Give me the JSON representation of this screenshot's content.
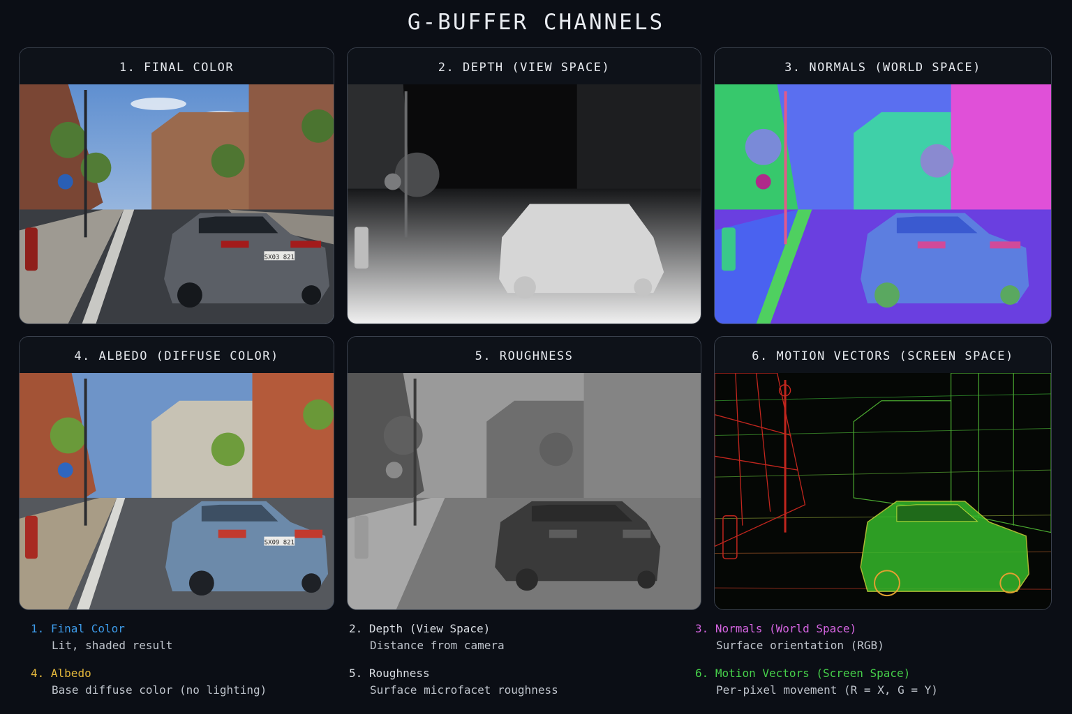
{
  "title": "G-BUFFER CHANNELS",
  "panels": [
    {
      "header": "1. FINAL COLOR"
    },
    {
      "header": "2. DEPTH (VIEW SPACE)"
    },
    {
      "header": "3. NORMALS (WORLD SPACE)"
    },
    {
      "header": "4. ALBEDO (DIFFUSE COLOR)"
    },
    {
      "header": "5. ROUGHNESS"
    },
    {
      "header": "6. MOTION VECTORS (SCREEN SPACE)"
    }
  ],
  "plates": {
    "final": "SX03 821",
    "albedo": "SX09 821"
  },
  "legend": [
    {
      "num": "1.",
      "name": "Final Color",
      "desc": "Lit, shaded result",
      "color": "#3d9be9"
    },
    {
      "num": "2.",
      "name": "Depth (View Space)",
      "desc": "Distance from camera",
      "color": "#d9dde3"
    },
    {
      "num": "3.",
      "name": "Normals (World Space)",
      "desc": "Surface orientation (RGB)",
      "color": "#d464e0"
    },
    {
      "num": "4.",
      "name": "Albedo",
      "desc": "Base diffuse color (no lighting)",
      "color": "#e6b93c"
    },
    {
      "num": "5.",
      "name": "Roughness",
      "desc": "Surface microfacet roughness",
      "color": "#d9dde3"
    },
    {
      "num": "6.",
      "name": "Motion Vectors (Screen Space)",
      "desc": "Per-pixel movement (R = X, G = Y)",
      "color": "#46d04a"
    }
  ]
}
